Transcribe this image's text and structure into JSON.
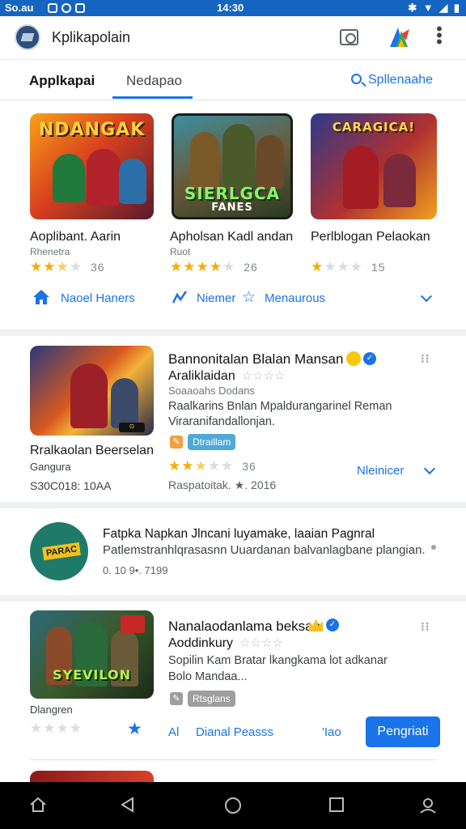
{
  "status": {
    "left": "So.au",
    "time": "14:30"
  },
  "appbar": {
    "title": "Kplikapolain"
  },
  "tabs": {
    "tab1": "Applkapai",
    "tab2": "Nedapao",
    "search": "Spllenaahe"
  },
  "featured": [
    {
      "thumb_title": "NDANGAK",
      "title": "Aoplibant. Aarin",
      "sub": "Rhenetra",
      "rating": 2.5,
      "count": "36"
    },
    {
      "thumb_title": "SIERLGCA",
      "thumb_sub": "FANES",
      "title": "Apholsan Kadl andan",
      "sub": "Ruot",
      "rating": 4,
      "count": "26"
    },
    {
      "thumb_title": "CARAGICA!",
      "title": "Perlblogan Pelaokan",
      "sub": "",
      "rating": 1,
      "count": "15"
    }
  ],
  "links": {
    "l1": "Naoel Haners",
    "l2": "Niemer",
    "l3": "Menaurous"
  },
  "item1": {
    "title": "Bannonitalan Blalan Mansan",
    "subtitle": "Araliklaidan",
    "dev": "Soaaoahs Dodans",
    "desc1": "Raalkarins Bnlan Mpaldurangarinel Reman",
    "desc2": "Viraranifandallonjan.",
    "badge": "Dtraillam",
    "left_title": "Rralkaolan Beerselan",
    "left_sub": "Gangura",
    "left_price": "S30C018: 10AA",
    "rating": 2.5,
    "count": "36",
    "link": "Nleinicer",
    "meta": "Raspatoitak. ★. 2016"
  },
  "item2": {
    "title": "Fatpka Napkan Jlncani luyamake, laaian Pagnral",
    "desc": "Patlemstranhlqrasasnn Uuardanan balvanlagbane plangian.",
    "meta": "0. 10 9•. 7199",
    "logo_text": "PARAC"
  },
  "item3": {
    "title": "Nanalaodanlama beksan",
    "subtitle": "Aoddinkury",
    "desc1": "Sopilin Kam Bratar lkangkama lot adkanar",
    "desc2": "Bolo Mandaa...",
    "badge": "Rtsglans",
    "left_sub": "Dlangren",
    "thumb_title": "SYEVILON",
    "link_a": "Al",
    "link_b": "Dianal Peasss",
    "link_c": "'Iao",
    "button": "Pengriati"
  },
  "colors": {
    "primary": "#1a73e8",
    "status": "#1565c0",
    "star": "#f9ab00"
  }
}
